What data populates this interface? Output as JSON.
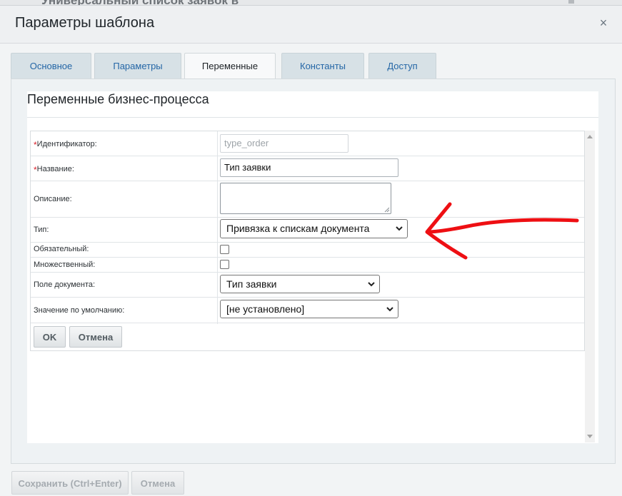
{
  "background": {
    "title": "Универсальный список заявок в"
  },
  "dialog": {
    "title": "Параметры шаблона",
    "close_glyph": "×"
  },
  "tabs": [
    {
      "label": "Основное",
      "active": false
    },
    {
      "label": "Параметры",
      "active": false
    },
    {
      "label": "Переменные",
      "active": true
    },
    {
      "label": "Константы",
      "active": false
    },
    {
      "label": "Доступ",
      "active": false
    }
  ],
  "section": {
    "title": "Переменные бизнес-процесса"
  },
  "form": {
    "required_mark": "*",
    "identifier": {
      "label": "Идентификатор:",
      "placeholder": "type_order"
    },
    "name": {
      "label": "Название:",
      "value": "Тип заявки"
    },
    "description": {
      "label": "Описание:",
      "value": ""
    },
    "type": {
      "label": "Тип:",
      "value": "Привязка к спискам документа"
    },
    "required": {
      "label": "Обязательный:",
      "checked": false
    },
    "multiple": {
      "label": "Множественный:",
      "checked": false
    },
    "doc_field": {
      "label": "Поле документа:",
      "value": "Тип заявки"
    },
    "default_value": {
      "label": "Значение по умолчанию:",
      "value": "[не установлено]"
    },
    "ok_label": "OK",
    "cancel_label": "Отмена"
  },
  "footer": {
    "save_label": "Сохранить (Ctrl+Enter)",
    "cancel_label": "Отмена"
  },
  "annotation": {
    "color": "#ee0f13"
  },
  "icons": {
    "close": "close-icon",
    "chevron": "chevron-down-icon",
    "scroll_up": "scroll-up-icon",
    "scroll_down": "scroll-down-icon",
    "resize": "resize-grip-icon"
  }
}
